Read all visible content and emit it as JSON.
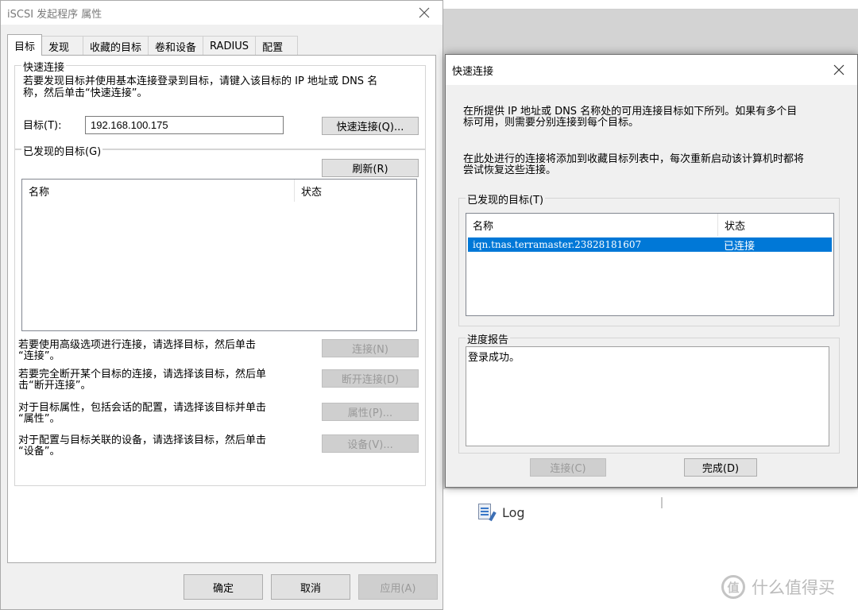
{
  "main_dialog": {
    "title": "iSCSI 发起程序 属性",
    "tabs": [
      {
        "label": "目标",
        "active": true
      },
      {
        "label": "发现"
      },
      {
        "label": "收藏的目标"
      },
      {
        "label": "卷和设备"
      },
      {
        "label": "RADIUS"
      },
      {
        "label": "配置"
      }
    ],
    "quick_connect_group": {
      "title": "快速连接",
      "description_line1": "若要发现目标并使用基本连接登录到目标，请键入该目标的 IP 地址或 DNS 名",
      "description_line2": "称，然后单击“快速连接”。",
      "target_label": "目标(T):",
      "target_value": "192.168.100.175",
      "quick_connect_button": "快速连接(Q)..."
    },
    "discovered_group": {
      "title": "已发现的目标(G)",
      "refresh_button": "刷新(R)",
      "columns": [
        "名称",
        "状态"
      ]
    },
    "actions": [
      {
        "line1": "若要使用高级选项进行连接，请选择目标，然后单击",
        "line2": "“连接”。",
        "button": "连接(N)"
      },
      {
        "line1": "若要完全断开某个目标的连接，请选择该目标，然后单",
        "line2": "击“断开连接”。",
        "button": "断开连接(D)"
      },
      {
        "line1": "对于目标属性，包括会话的配置，请选择该目标并单击",
        "line2": "“属性”。",
        "button": "属性(P)..."
      },
      {
        "line1": "对于配置与目标关联的设备，请选择该目标，然后单击",
        "line2": "“设备”。",
        "button": "设备(V)..."
      }
    ],
    "buttons": {
      "ok": "确定",
      "cancel": "取消",
      "apply": "应用(A)"
    }
  },
  "quick_connect_dialog": {
    "title": "快速连接",
    "paragraph1_line1": "在所提供 IP 地址或 DNS 名称处的可用连接目标如下所列。如果有多个目",
    "paragraph1_line2": "标可用，则需要分别连接到每个目标。",
    "paragraph2_line1": "在此处进行的连接将添加到收藏目标列表中，每次重新启动该计算机时都将",
    "paragraph2_line2": "尝试恢复这些连接。",
    "discovered_title": "已发现的目标(T)",
    "columns": [
      "名称",
      "状态"
    ],
    "rows": [
      {
        "name": "iqn.tnas.terramaster.23828181607",
        "status": "已连接"
      }
    ],
    "progress_title": "进度报告",
    "progress_text": "登录成功。",
    "buttons": {
      "connect": "连接(C)",
      "done": "完成(D)"
    }
  },
  "background": {
    "log_label": "Log",
    "watermark": "什么值得买",
    "watermark_icon": "值"
  },
  "colors": {
    "selection": "#0078d7",
    "dialog_bg": "#f0f0f0"
  }
}
